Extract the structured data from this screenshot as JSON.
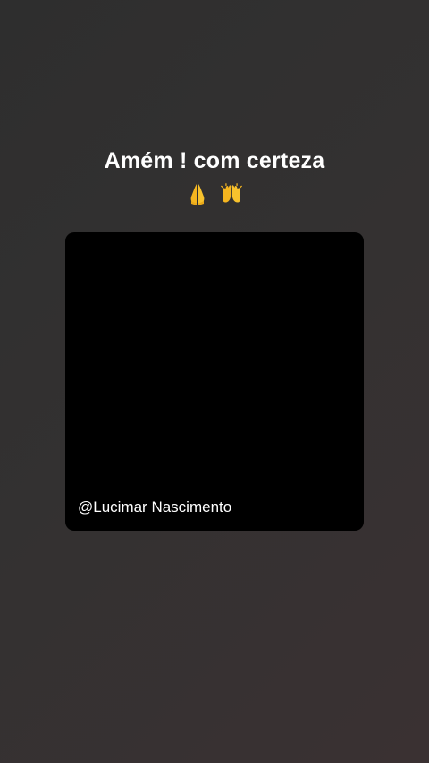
{
  "story": {
    "caption": "Amém ! com certeza",
    "emojis": [
      "folded-hands-icon",
      "raising-hands-icon"
    ],
    "media": {
      "credit": "@Lucimar Nascimento"
    }
  }
}
